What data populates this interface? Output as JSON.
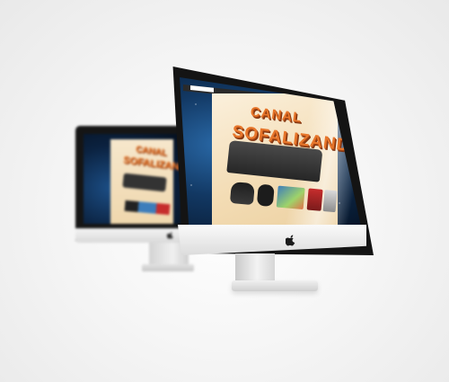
{
  "scene": {
    "description_colors": {
      "background": "#efefef",
      "bezel": "#141414",
      "aluminum": "#e6e6e6",
      "screen_blue": "#123863",
      "website_bg": "#f3dcb4",
      "brand_orange": "#e7762b"
    }
  },
  "front_monitor": {
    "website": {
      "brand_line1": "CANAL",
      "brand_line2": "SOFALIZANDO"
    },
    "logo_icon": "apple-logo-icon"
  },
  "back_monitor": {
    "website": {
      "brand_line1": "CANAL",
      "brand_line2": "SOFALIZANDO"
    },
    "logo_icon": "apple-logo-icon"
  }
}
